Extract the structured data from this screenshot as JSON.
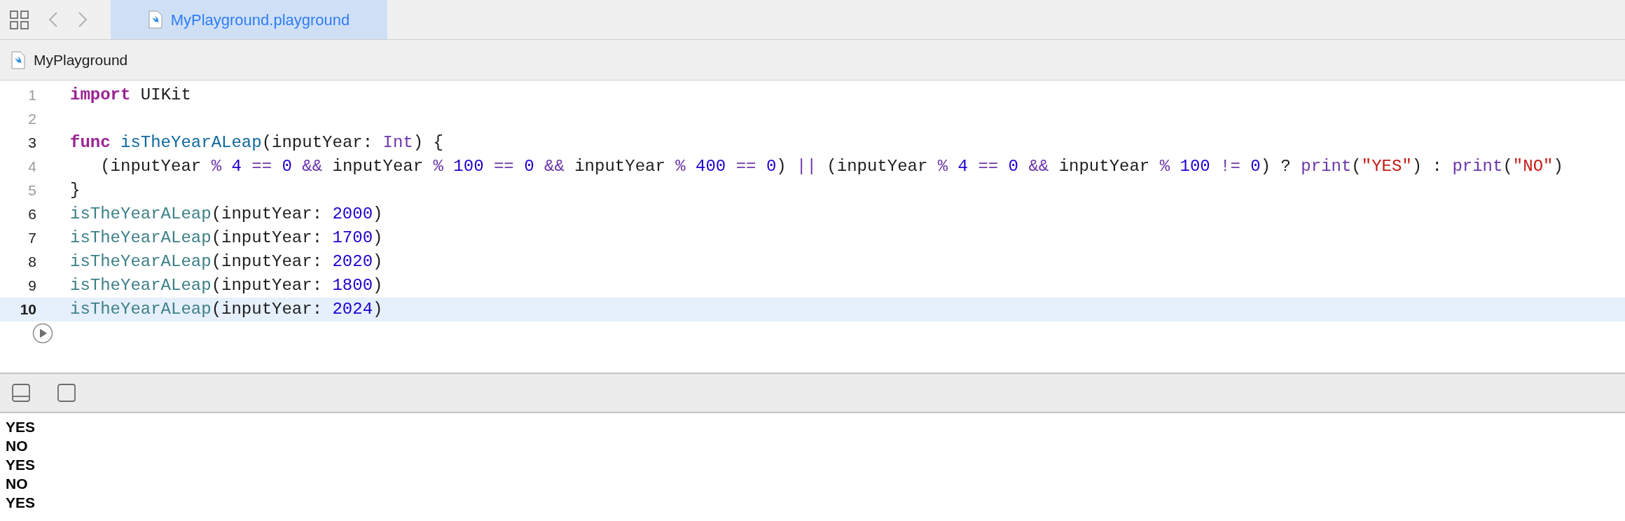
{
  "tab": {
    "label": "MyPlayground.playground",
    "selected": true
  },
  "breadcrumb": {
    "label": "MyPlayground"
  },
  "editor": {
    "lines": [
      {
        "number": "1",
        "dimmed": true,
        "selected": false,
        "tokens": [
          {
            "text": "import",
            "kind": "keyword"
          },
          {
            "text": " UIKit",
            "kind": "plain"
          }
        ]
      },
      {
        "number": "2",
        "dimmed": true,
        "selected": false
      },
      {
        "number": "3",
        "dimmed": false,
        "selected": false,
        "tokens": [
          {
            "text": "func",
            "kind": "keyword"
          },
          {
            "text": " isTheYearALeap",
            "kind": "declaration"
          },
          {
            "text": "(inputYear: ",
            "kind": "plain"
          },
          {
            "text": "Int",
            "kind": "type"
          },
          {
            "text": ") {",
            "kind": "plain"
          }
        ]
      },
      {
        "number": "4",
        "dimmed": true,
        "selected": false,
        "tokens": [
          {
            "text": "   (inputYear",
            "kind": "plain"
          },
          {
            "text": " %",
            "kind": "operator"
          },
          {
            "text": " 4",
            "kind": "number"
          },
          {
            "text": " ==",
            "kind": "operator"
          },
          {
            "text": " 0",
            "kind": "number"
          },
          {
            "text": " &&",
            "kind": "operator"
          },
          {
            "text": " inputYear",
            "kind": "plain"
          },
          {
            "text": " %",
            "kind": "operator"
          },
          {
            "text": " 100",
            "kind": "number"
          },
          {
            "text": " ==",
            "kind": "operator"
          },
          {
            "text": " 0",
            "kind": "number"
          },
          {
            "text": " &&",
            "kind": "operator"
          },
          {
            "text": " inputYear",
            "kind": "plain"
          },
          {
            "text": " %",
            "kind": "operator"
          },
          {
            "text": " 400",
            "kind": "number"
          },
          {
            "text": " ==",
            "kind": "operator"
          },
          {
            "text": " 0",
            "kind": "number"
          },
          {
            "text": ")",
            "kind": "plain"
          },
          {
            "text": " ||",
            "kind": "operator"
          },
          {
            "text": " (inputYear",
            "kind": "plain"
          },
          {
            "text": " %",
            "kind": "operator"
          },
          {
            "text": " 4",
            "kind": "number"
          },
          {
            "text": " ==",
            "kind": "operator"
          },
          {
            "text": " 0",
            "kind": "number"
          },
          {
            "text": " &&",
            "kind": "operator"
          },
          {
            "text": " inputYear",
            "kind": "plain"
          },
          {
            "text": " %",
            "kind": "operator"
          },
          {
            "text": " 100",
            "kind": "number"
          },
          {
            "text": " !=",
            "kind": "operator"
          },
          {
            "text": " 0",
            "kind": "number"
          },
          {
            "text": ") ?",
            "kind": "plain"
          },
          {
            "text": " print",
            "kind": "library"
          },
          {
            "text": "(",
            "kind": "plain"
          },
          {
            "text": "\"YES\"",
            "kind": "string"
          },
          {
            "text": ") :",
            "kind": "plain"
          },
          {
            "text": " print",
            "kind": "library"
          },
          {
            "text": "(",
            "kind": "plain"
          },
          {
            "text": "\"NO\"",
            "kind": "string"
          },
          {
            "text": ")",
            "kind": "plain"
          }
        ]
      },
      {
        "number": "5",
        "dimmed": true,
        "selected": false,
        "tokens": [
          {
            "text": "}",
            "kind": "plain"
          }
        ]
      },
      {
        "number": "6",
        "dimmed": false,
        "selected": false,
        "tokens": [
          {
            "text": "isTheYearALeap",
            "kind": "call"
          },
          {
            "text": "(inputYear: ",
            "kind": "plain"
          },
          {
            "text": "2000",
            "kind": "number"
          },
          {
            "text": ")",
            "kind": "plain"
          }
        ]
      },
      {
        "number": "7",
        "dimmed": false,
        "selected": false,
        "tokens": [
          {
            "text": "isTheYearALeap",
            "kind": "call"
          },
          {
            "text": "(inputYear: ",
            "kind": "plain"
          },
          {
            "text": "1700",
            "kind": "number"
          },
          {
            "text": ")",
            "kind": "plain"
          }
        ]
      },
      {
        "number": "8",
        "dimmed": false,
        "selected": false,
        "tokens": [
          {
            "text": "isTheYearALeap",
            "kind": "call"
          },
          {
            "text": "(inputYear: ",
            "kind": "plain"
          },
          {
            "text": "2020",
            "kind": "number"
          },
          {
            "text": ")",
            "kind": "plain"
          }
        ]
      },
      {
        "number": "9",
        "dimmed": false,
        "selected": false,
        "tokens": [
          {
            "text": "isTheYearALeap",
            "kind": "call"
          },
          {
            "text": "(inputYear: ",
            "kind": "plain"
          },
          {
            "text": "1800",
            "kind": "number"
          },
          {
            "text": ")",
            "kind": "plain"
          }
        ]
      },
      {
        "number": "10",
        "dimmed": false,
        "selected": true,
        "tokens": [
          {
            "text": "isTheYearALeap",
            "kind": "call"
          },
          {
            "text": "(inputYear: ",
            "kind": "plain"
          },
          {
            "text": "2024",
            "kind": "number"
          },
          {
            "text": ")",
            "kind": "plain"
          }
        ]
      }
    ]
  },
  "console": {
    "output": [
      "YES",
      "NO",
      "YES",
      "NO",
      "YES"
    ]
  }
}
